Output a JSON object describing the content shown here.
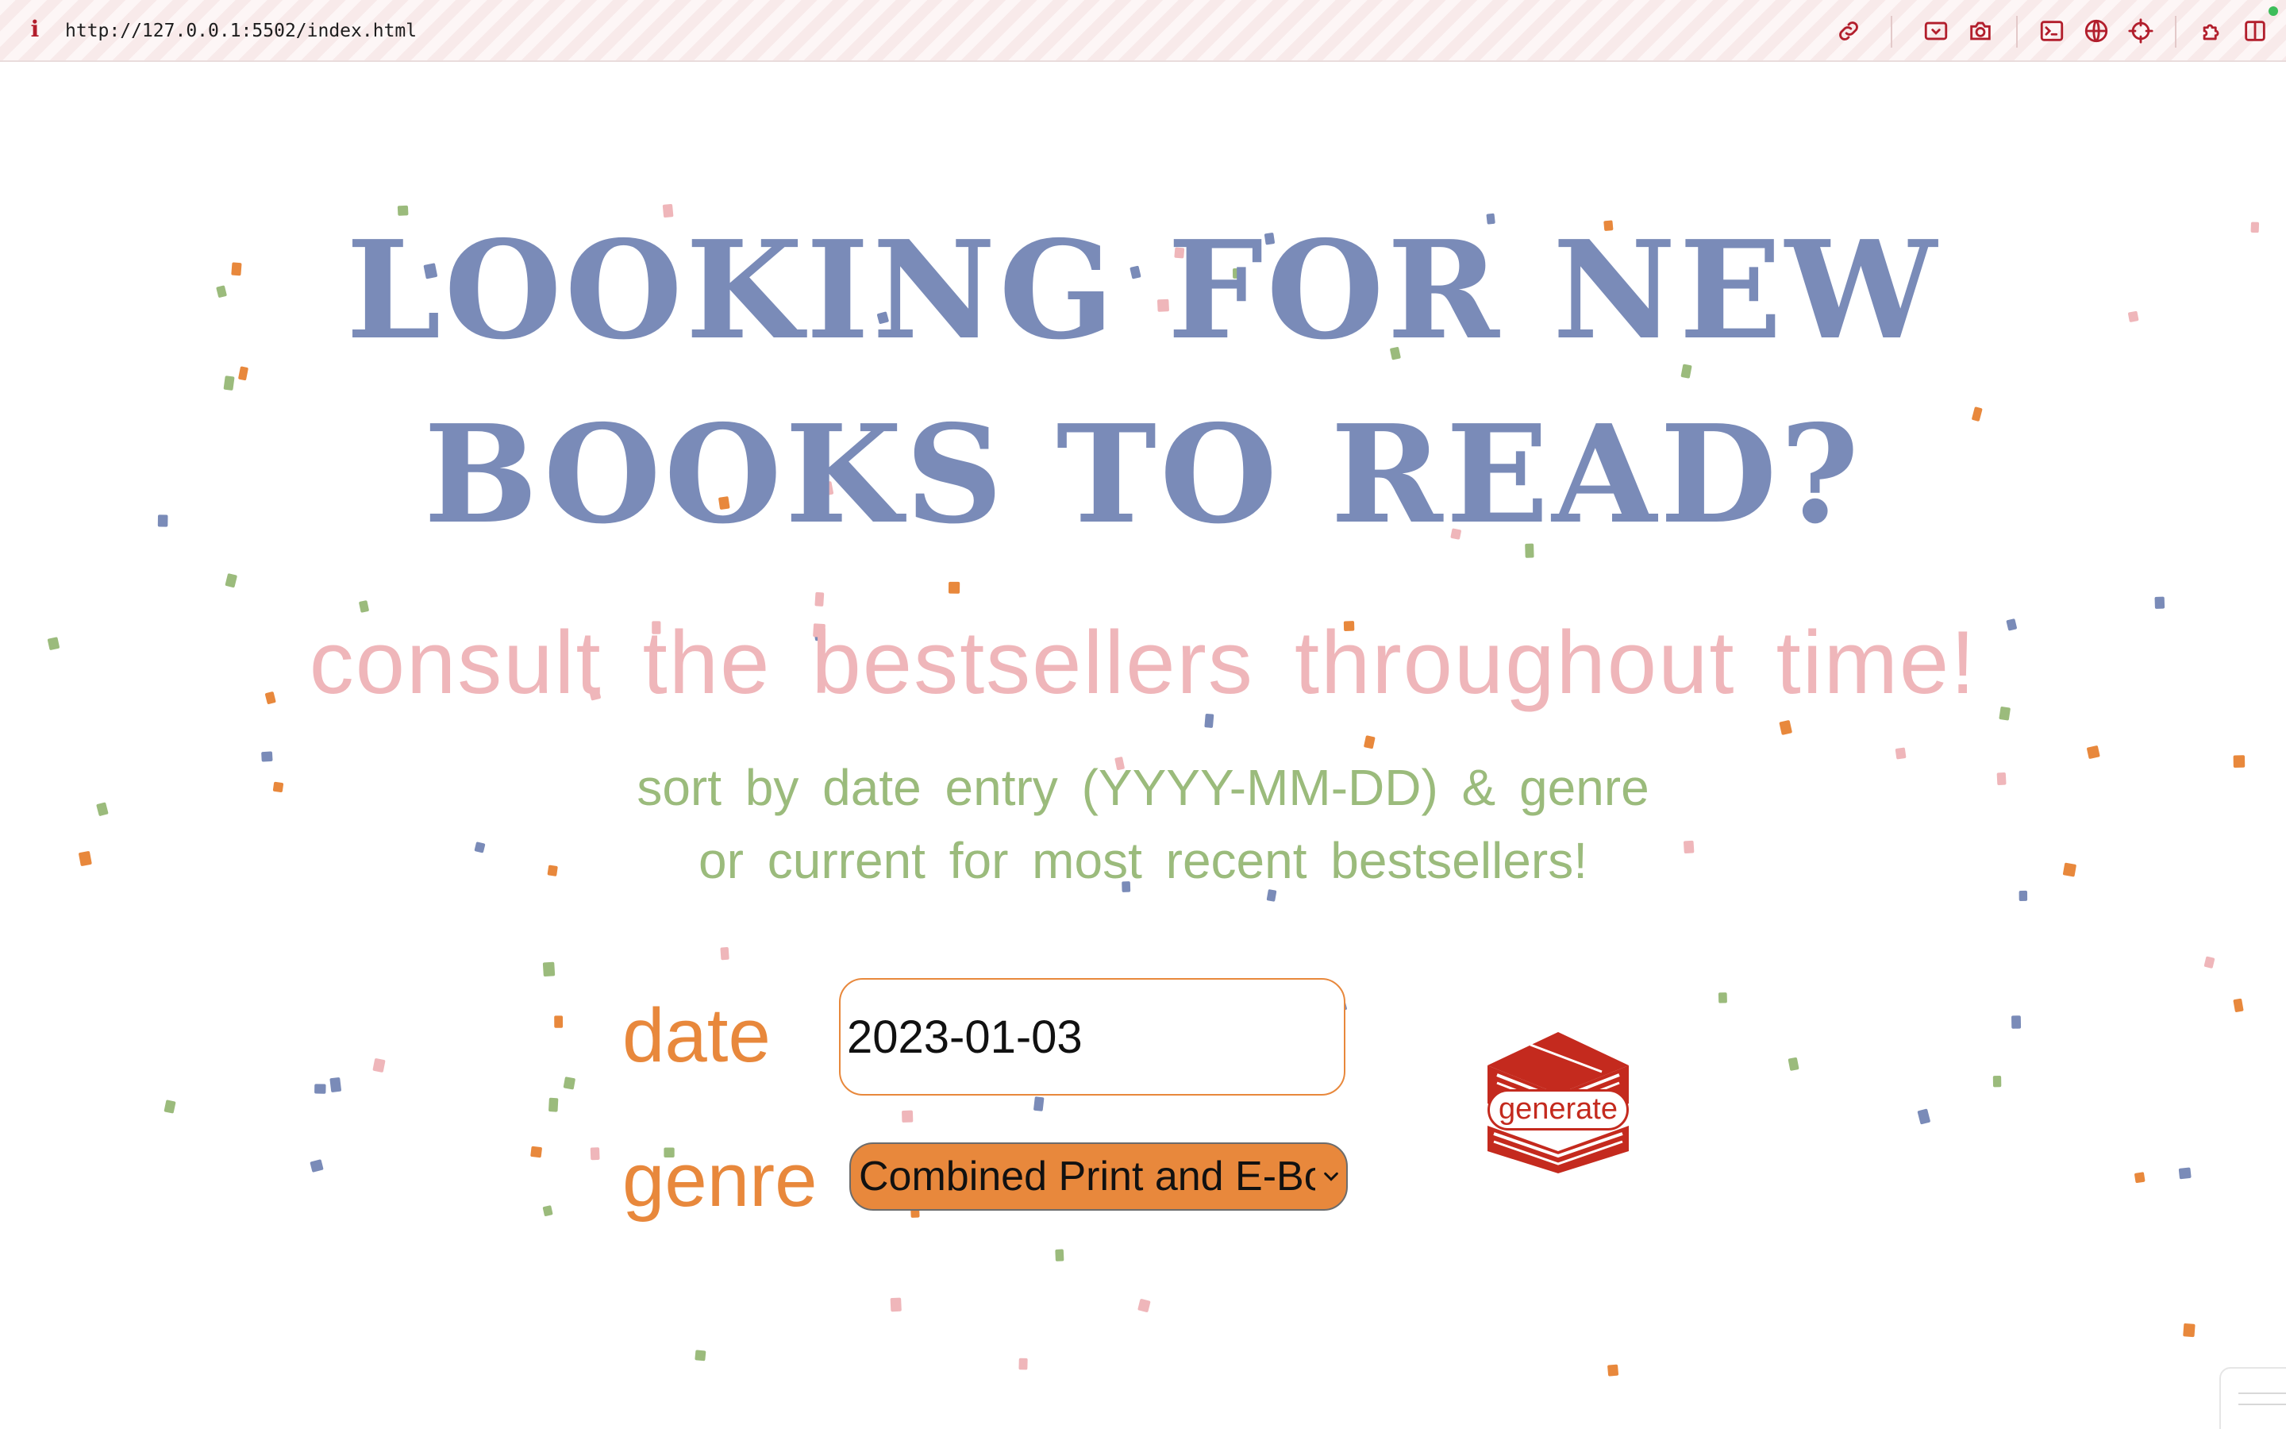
{
  "browser": {
    "url": "http://127.0.0.1:5502/index.html",
    "info_icon": "i",
    "icons": [
      "link-icon",
      "screenshot-region-icon",
      "camera-icon",
      "terminal-icon",
      "globe-icon",
      "crosshair-icon",
      "extensions-icon",
      "split-view-icon"
    ]
  },
  "hero": {
    "headline": "LOOKING FOR NEW BOOKS TO READ?",
    "tagline": "consult the bestsellers throughout time!",
    "instructions": [
      "sort by date entry (YYYY-MM-DD) & genre",
      "or current for most recent bestsellers!"
    ]
  },
  "form": {
    "date_label": "date",
    "date_value": "2023-01-03",
    "genre_label": "genre",
    "genre_selected": "Combined Print and E-Book Fiction",
    "generate_label": "generate"
  },
  "colors": {
    "headline": "#7a8bb8",
    "tagline": "#efb6ba",
    "instructions": "#9bbb7c",
    "labels": "#e8883c",
    "select_fill": "#e8883c",
    "generate_button": "#c42a1e",
    "confetti": [
      "#7a8bb8",
      "#efb6ba",
      "#9bbb7c",
      "#e8883c"
    ]
  }
}
